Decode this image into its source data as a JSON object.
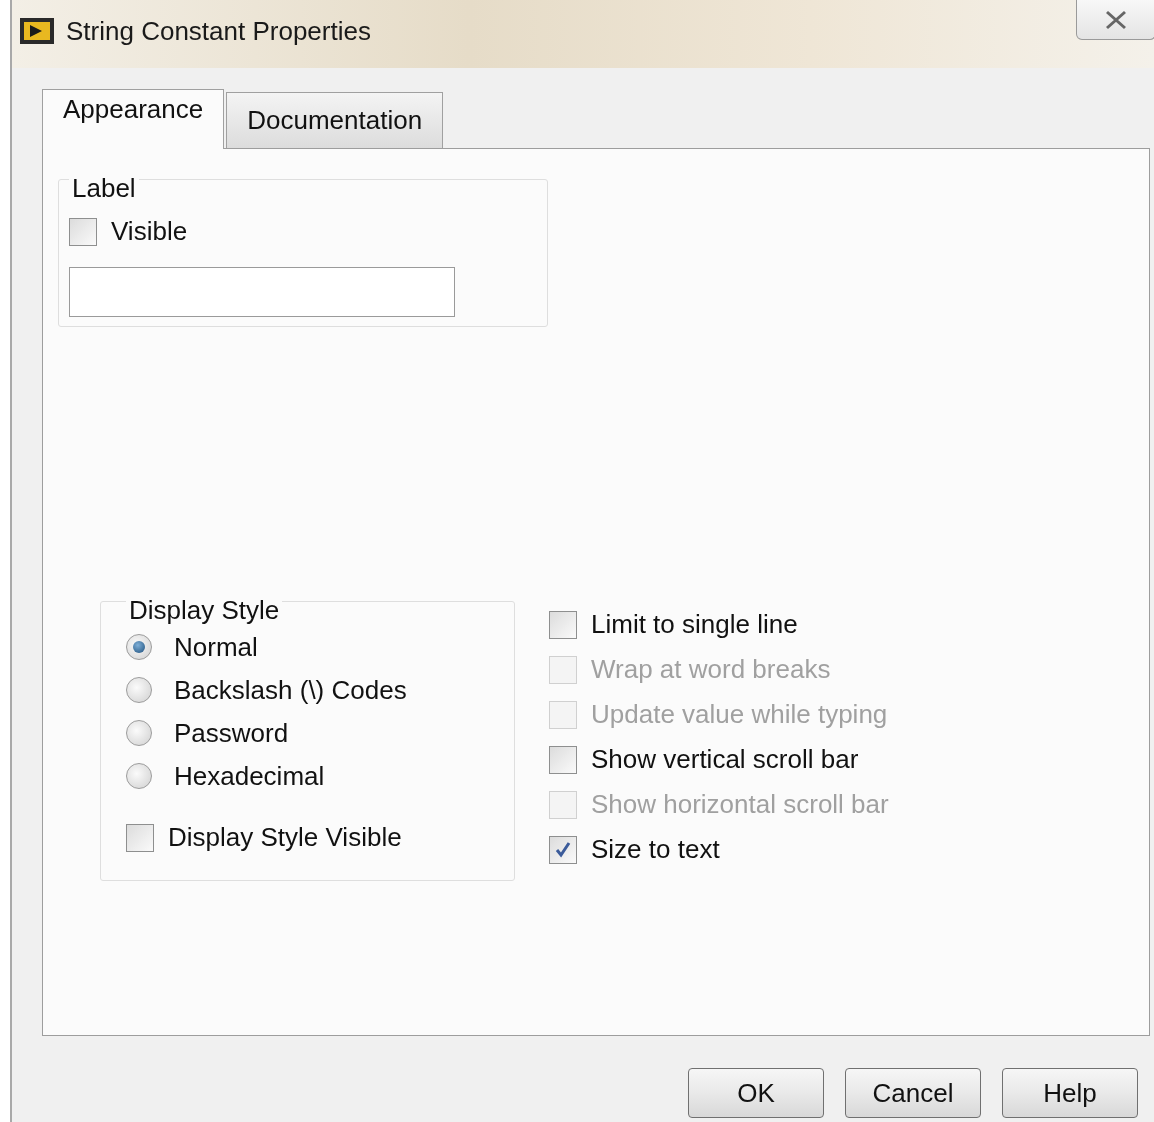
{
  "window": {
    "title": "String Constant Properties"
  },
  "tabs": [
    {
      "label": "Appearance",
      "selected": true
    },
    {
      "label": "Documentation",
      "selected": false
    }
  ],
  "label_group": {
    "title": "Label",
    "visible": {
      "label": "Visible",
      "checked": false
    }
  },
  "display_style": {
    "title": "Display Style",
    "options": [
      {
        "label": "Normal",
        "selected": true
      },
      {
        "label": "Backslash (\\) Codes",
        "selected": false
      },
      {
        "label": "Password",
        "selected": false
      },
      {
        "label": "Hexadecimal",
        "selected": false
      }
    ],
    "visible_checkbox": {
      "label": "Display Style Visible",
      "checked": false
    }
  },
  "options": [
    {
      "label": "Limit to single line",
      "checked": false,
      "disabled": false
    },
    {
      "label": "Wrap at word breaks",
      "checked": false,
      "disabled": true
    },
    {
      "label": "Update value while typing",
      "checked": false,
      "disabled": true
    },
    {
      "label": "Show vertical scroll bar",
      "checked": false,
      "disabled": false
    },
    {
      "label": "Show horizontal scroll bar",
      "checked": false,
      "disabled": true
    },
    {
      "label": "Size to text",
      "checked": true,
      "disabled": false
    }
  ],
  "buttons": [
    "OK",
    "Cancel",
    "Help"
  ]
}
